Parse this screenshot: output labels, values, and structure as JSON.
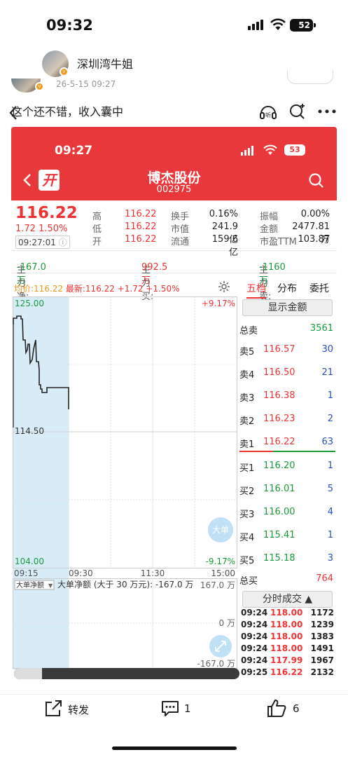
{
  "status_bar": {
    "time": "09:32",
    "battery": "52"
  },
  "nav": {
    "author": "深圳湾牛姐"
  },
  "post": {
    "date": "26-5-15 09:27",
    "text": "这个还不错，收入囊中"
  },
  "screenshot": {
    "status_time": "09:27",
    "battery": "53",
    "open_badge": "开",
    "stock_name": "博杰股份",
    "stock_code": "002975",
    "price": "116.22",
    "change": "1.72 1.50%",
    "quote_time": "09:27:01",
    "quote_rows": [
      {
        "l1": "高",
        "v1": "116.22",
        "l2": "换手",
        "v2": "0.16%",
        "l3": "振幅",
        "v3": "0.00%"
      },
      {
        "l1": "低",
        "v1": "116.22",
        "l2": "市值",
        "v2": "241.9亿",
        "l3": "金额",
        "v3": "2477.81万"
      },
      {
        "l1": "开",
        "v1": "116.22",
        "l2": "流通",
        "v2": "159.6亿",
        "l3": "市盈TTM",
        "v3": "103.87"
      }
    ],
    "flow": {
      "net_label": "主力净:",
      "net_value": "-167.0万",
      "buy_label": "主力买:",
      "buy_value": "992.5万",
      "sell_label": "主力卖:",
      "sell_value": "-1160万"
    },
    "legend": {
      "avg": "均价:116.22",
      "latest": "最新:116.22 +1.72 +1.50%"
    },
    "chart": {
      "y_top": "125.00",
      "y_mid": "114.50",
      "y_bottom": "104.00",
      "pct_top": "+9.17%",
      "pct_bottom": "-9.17%",
      "x_labels": [
        "09:15",
        "09:30",
        "11:30",
        "15:00"
      ],
      "big_order_badge": "大单",
      "sub_selector": "大单净额",
      "sub_title": "大单净额 (大于 30 万元): -167.0 万",
      "sub_top": "167.0 万",
      "sub_mid": "0 万",
      "sub_bottom": "-167.0 万"
    },
    "tabs": [
      "五档",
      "分布",
      "委托"
    ],
    "show_amount_button": "显示金额",
    "total_sell": {
      "label": "总卖",
      "value": "3561"
    },
    "asks": [
      {
        "label": "卖5",
        "price": "116.57",
        "vol": "30"
      },
      {
        "label": "卖4",
        "price": "116.50",
        "vol": "21"
      },
      {
        "label": "卖3",
        "price": "116.38",
        "vol": "1"
      },
      {
        "label": "卖2",
        "price": "116.23",
        "vol": "2"
      },
      {
        "label": "卖1",
        "price": "116.22",
        "vol": "63"
      }
    ],
    "bids": [
      {
        "label": "买1",
        "price": "116.20",
        "vol": "1"
      },
      {
        "label": "买2",
        "price": "116.01",
        "vol": "5"
      },
      {
        "label": "买3",
        "price": "116.00",
        "vol": "4"
      },
      {
        "label": "买4",
        "price": "115.41",
        "vol": "1"
      },
      {
        "label": "买5",
        "price": "115.18",
        "vol": "3"
      }
    ],
    "total_buy": {
      "label": "总买",
      "value": "764"
    },
    "ticks_header": "分时成交",
    "ticks": [
      {
        "time": "09:24",
        "price": "118.00",
        "vol": "1172"
      },
      {
        "time": "09:24",
        "price": "118.00",
        "vol": "1239"
      },
      {
        "time": "09:24",
        "price": "118.00",
        "vol": "1383"
      },
      {
        "time": "09:24",
        "price": "118.00",
        "vol": "1491"
      },
      {
        "time": "09:24",
        "price": "117.99",
        "vol": "1967"
      },
      {
        "time": "09:25",
        "price": "116.22",
        "vol": "2132"
      }
    ]
  },
  "actions": {
    "forward": "转发",
    "comments": "1",
    "likes": "6"
  }
}
